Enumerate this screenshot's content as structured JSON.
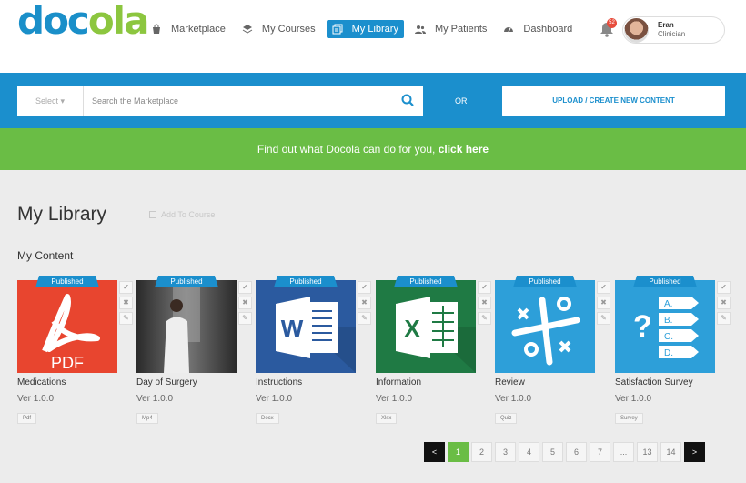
{
  "brand": {
    "logo_part1": "doc",
    "logo_part2": "ola"
  },
  "nav": [
    {
      "label": "Marketplace",
      "icon": "shopping-bag-icon"
    },
    {
      "label": "My Courses",
      "icon": "layers-icon"
    },
    {
      "label": "My Library",
      "icon": "library-icon",
      "active": true
    },
    {
      "label": "My Patients",
      "icon": "users-icon"
    },
    {
      "label": "Dashboard",
      "icon": "dashboard-icon"
    }
  ],
  "notifications": {
    "count": "52"
  },
  "user": {
    "name": "Eran",
    "role": "Clinician"
  },
  "search": {
    "select_label": "Select",
    "placeholder": "Search the Marketplace",
    "or_label": "OR",
    "upload_label": "UPLOAD / CREATE NEW CONTENT"
  },
  "banner": {
    "text": "Find out what Docola can do for you, ",
    "link": "click here"
  },
  "page": {
    "title": "My Library",
    "add_to_course": "Add To Course",
    "section_title": "My Content"
  },
  "cards": [
    {
      "status": "Published",
      "title": "Medications",
      "version": "Ver 1.0.0",
      "type": "Pdf",
      "thumb": "pdf",
      "thumb_label": "PDF",
      "bg": "#e8452f"
    },
    {
      "status": "Published",
      "title": "Day of Surgery",
      "version": "Ver 1.0.0",
      "type": "Mp4",
      "thumb": "video",
      "thumb_label": "",
      "bg": "#444444"
    },
    {
      "status": "Published",
      "title": "Instructions",
      "version": "Ver 1.0.0",
      "type": "Docx",
      "thumb": "word",
      "thumb_label": "W",
      "bg": "#2b5a9f"
    },
    {
      "status": "Published",
      "title": "Information",
      "version": "Ver 1.0.0",
      "type": "Xlsx",
      "thumb": "excel",
      "thumb_label": "X",
      "bg": "#1f7a44"
    },
    {
      "status": "Published",
      "title": "Review",
      "version": "Ver 1.0.0",
      "type": "Quiz",
      "thumb": "quiz",
      "thumb_label": "",
      "bg": "#2d9fd9"
    },
    {
      "status": "Published",
      "title": "Satisfaction Survey",
      "version": "Ver 1.0.0",
      "type": "Survey",
      "thumb": "survey",
      "thumb_label": "",
      "bg": "#2d9fd9"
    }
  ],
  "survey_options": [
    "A.",
    "B.",
    "C.",
    "D."
  ],
  "pagination": {
    "prev": "<",
    "next": ">",
    "pages": [
      "1",
      "2",
      "3",
      "4",
      "5",
      "6",
      "7",
      "...",
      "13",
      "14"
    ],
    "current": "1"
  },
  "colors": {
    "brand_blue": "#1b8fcd",
    "brand_green": "#6abd45"
  }
}
